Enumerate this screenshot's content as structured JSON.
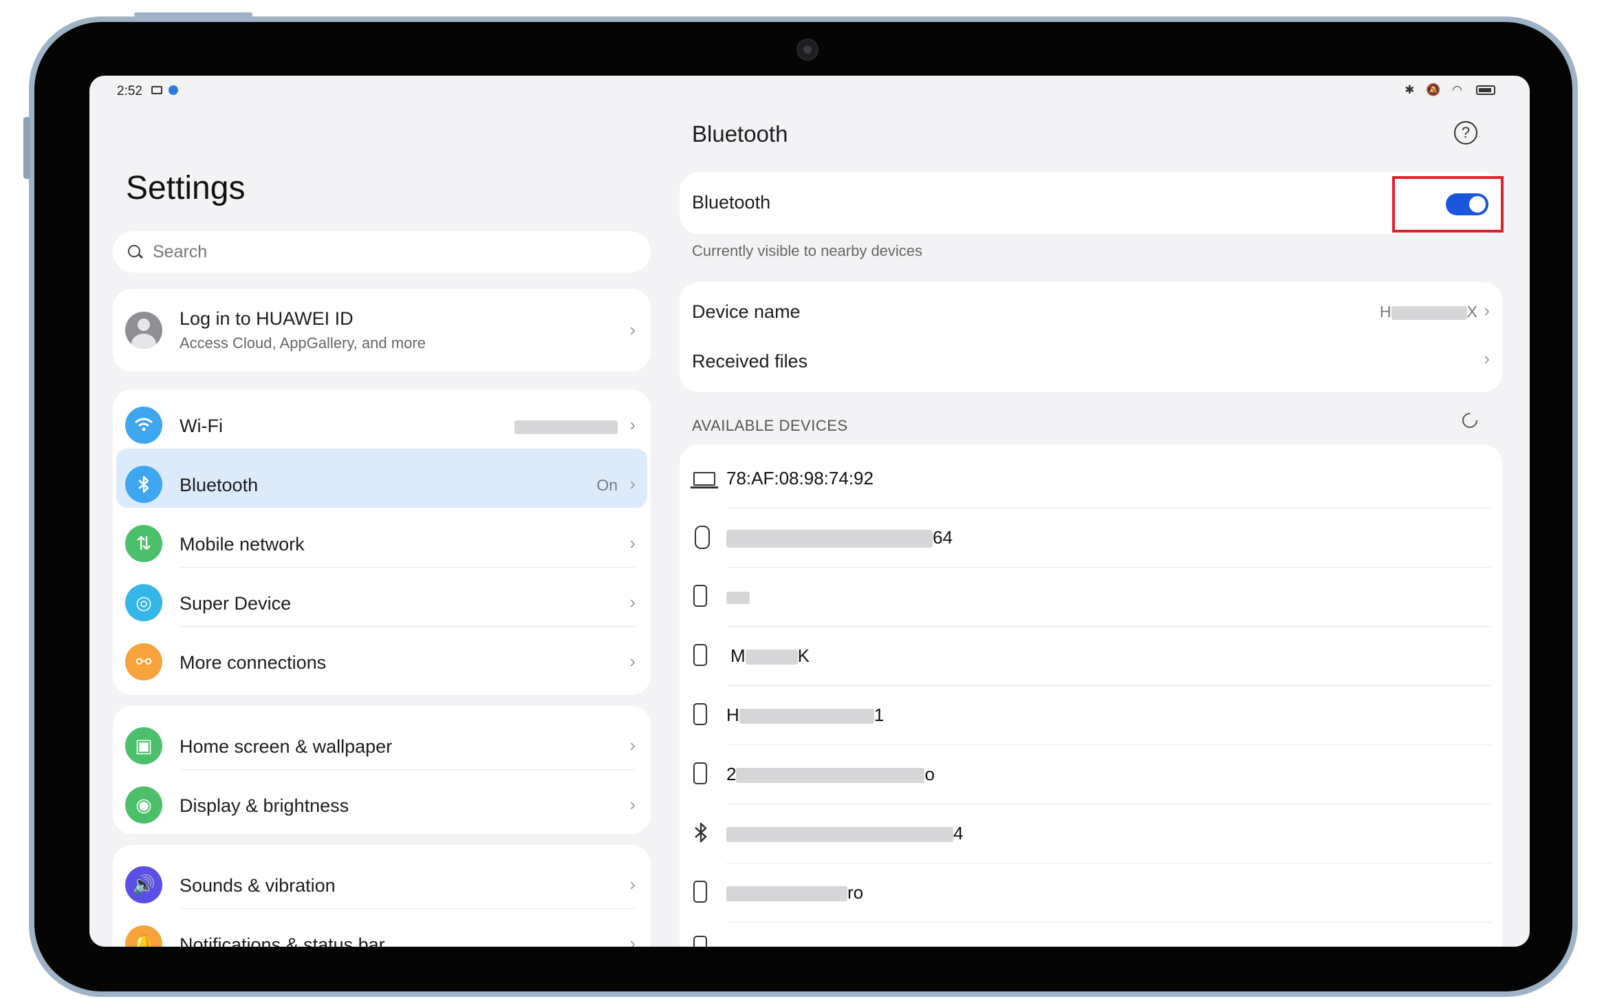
{
  "status_bar": {
    "time": "2:52"
  },
  "left": {
    "title": "Settings",
    "search_placeholder": "Search",
    "account": {
      "title": "Log in to HUAWEI ID",
      "subtitle": "Access Cloud, AppGallery, and more"
    },
    "group1": [
      {
        "label": "Wi-Fi",
        "value": "",
        "icon": "wifi-icon",
        "color": "#3ea6f0"
      },
      {
        "label": "Bluetooth",
        "value": "On",
        "icon": "bluetooth-icon",
        "color": "#3ea6f0"
      },
      {
        "label": "Mobile network",
        "value": "",
        "icon": "mobile-data-icon",
        "color": "#4cbf6a"
      },
      {
        "label": "Super Device",
        "value": "",
        "icon": "super-device-icon",
        "color": "#34b7e6"
      },
      {
        "label": "More connections",
        "value": "",
        "icon": "link-icon",
        "color": "#f7a23a"
      }
    ],
    "group2": [
      {
        "label": "Home screen & wallpaper",
        "icon": "wallpaper-icon",
        "color": "#4cbf6a"
      },
      {
        "label": "Display & brightness",
        "icon": "eye-icon",
        "color": "#4cbf6a"
      }
    ],
    "group3": [
      {
        "label": "Sounds & vibration",
        "icon": "speaker-icon",
        "color": "#5b4fe6"
      },
      {
        "label": "Notifications & status bar",
        "icon": "bell-icon",
        "color": "#f7a23a"
      }
    ]
  },
  "right": {
    "title": "Bluetooth",
    "toggle_label": "Bluetooth",
    "toggle_on": true,
    "visible_text": "Currently visible to nearby devices",
    "device_name_label": "Device name",
    "device_name_value_start": "H",
    "device_name_value_end": "X",
    "received_files_label": "Received files",
    "available_header": "AVAILABLE DEVICES",
    "devices": [
      {
        "icon": "laptop-icon",
        "name": "78:AF:08:98:74:92"
      },
      {
        "icon": "watch-icon",
        "name_start": "",
        "name_end": "64"
      },
      {
        "icon": "phone-icon",
        "name_start": "",
        "name_end": ""
      },
      {
        "icon": "phone-icon",
        "name_start": "M",
        "name_end": "K"
      },
      {
        "icon": "phone-icon",
        "name_start": "H",
        "name_end": "1"
      },
      {
        "icon": "phone-icon",
        "name_start": "2",
        "name_end": "o"
      },
      {
        "icon": "bluetooth-icon",
        "name_start": "",
        "name_end": "4"
      },
      {
        "icon": "phone-icon",
        "name_start": "",
        "name_end": "ro"
      }
    ]
  }
}
